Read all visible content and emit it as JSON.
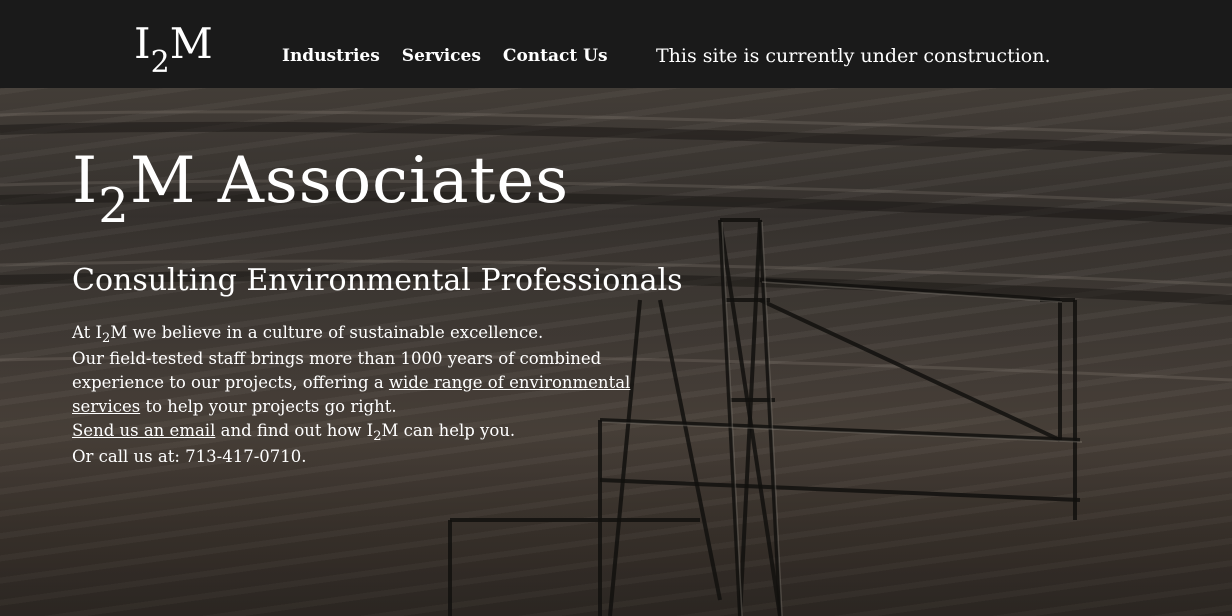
{
  "colors": {
    "navbar_bg": "#1a1a1a",
    "text": "#ffffff"
  },
  "navbar": {
    "logo": {
      "pre": "I",
      "sub": "2",
      "post": "M"
    },
    "links": [
      "Industries",
      "Services",
      "Contact Us"
    ],
    "notice": "This site is currently under construction."
  },
  "hero": {
    "title": {
      "pre": "I",
      "sub": "2",
      "post": "M Associates"
    },
    "subtitle": "Consulting Environmental Professionals",
    "intro": {
      "line1_pre": "At I",
      "line1_sub": "2",
      "line1_post": "M we believe in a culture of sustainable excellence.",
      "line2_pre": "Our field-tested staff brings more than 1000 years of combined experience to our projects, offering a ",
      "line2_link": "wide range of environmental services",
      "line2_post": " to help your projects go right."
    },
    "contact": {
      "email_link": "Send us an email",
      "email_post_pre": " and find out how I",
      "email_post_sub": "2",
      "email_post_post": "M can help you.",
      "phone_line": "Or call us at: 713-417-0710."
    }
  },
  "background": {
    "icon": "mining-excavator-photo"
  }
}
